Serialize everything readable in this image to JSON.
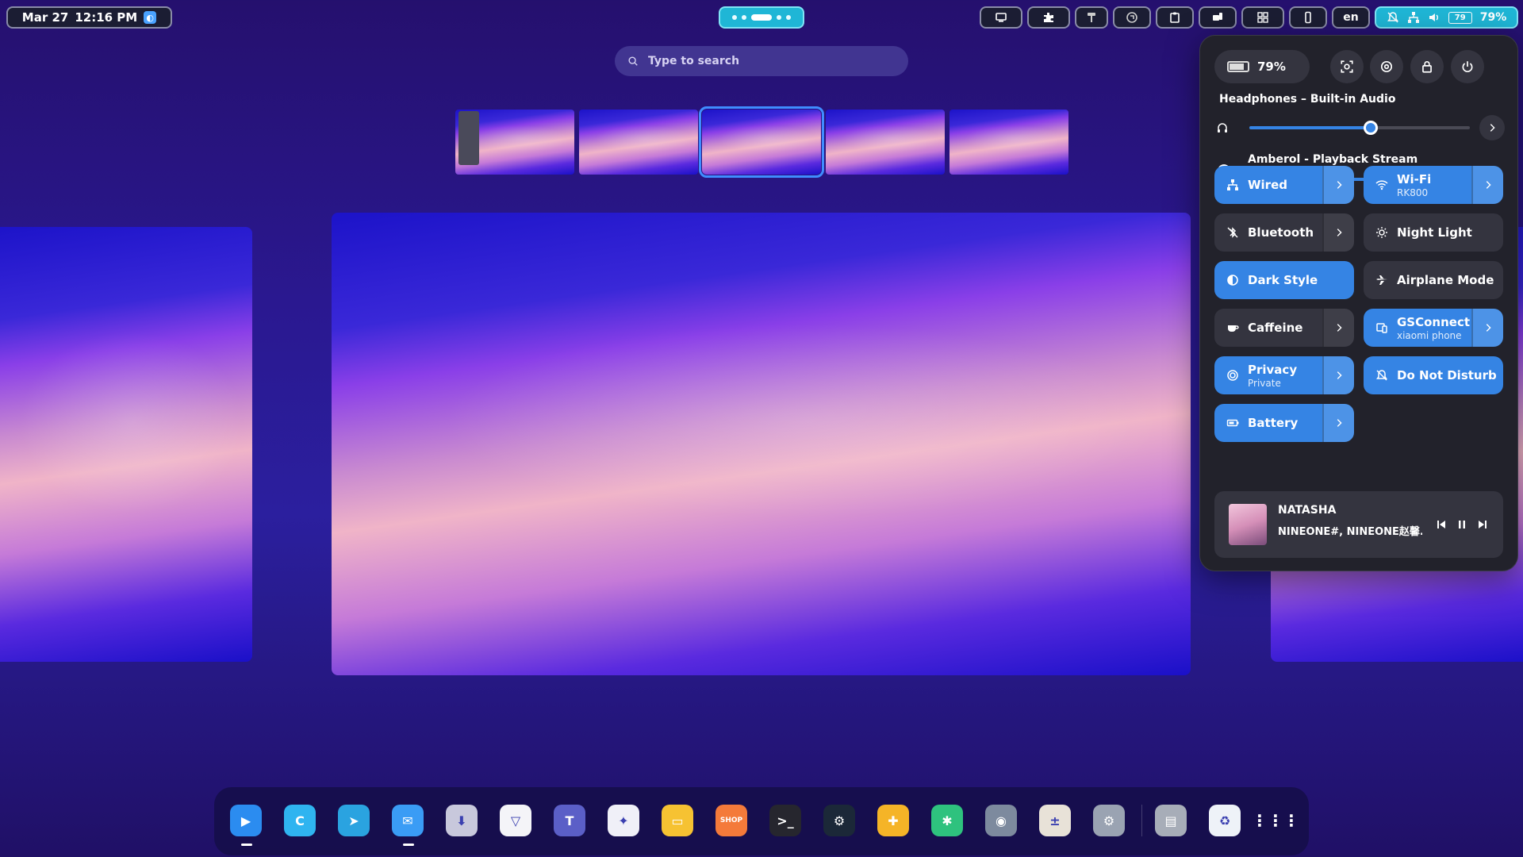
{
  "topbar": {
    "date": "Mar 27",
    "time": "12:16 PM",
    "tray_lang": "en",
    "tray_battery_icon_text": "79",
    "tray_battery_percent": "79%"
  },
  "search": {
    "placeholder": "Type to search"
  },
  "quick_settings": {
    "battery_percent": "79%",
    "output_device_label": "Headphones – Built-in Audio",
    "output_volume": 0.55,
    "stream_label": "Amberol - Playback Stream",
    "stream_volume": 0.52,
    "tiles": [
      {
        "label": "Wired",
        "sub": "",
        "on": true,
        "arrow": true
      },
      {
        "label": "Wi-Fi",
        "sub": "RK800",
        "on": true,
        "arrow": true
      },
      {
        "label": "Bluetooth",
        "sub": "",
        "on": false,
        "arrow": true
      },
      {
        "label": "Night Light",
        "sub": "",
        "on": false,
        "arrow": false
      },
      {
        "label": "Dark Style",
        "sub": "",
        "on": true,
        "arrow": false
      },
      {
        "label": "Airplane Mode",
        "sub": "",
        "on": false,
        "arrow": false
      },
      {
        "label": "Caffeine",
        "sub": "",
        "on": false,
        "arrow": true
      },
      {
        "label": "GSConnect",
        "sub": "xiaomi phone",
        "on": true,
        "arrow": true
      },
      {
        "label": "Privacy",
        "sub": "Private",
        "on": true,
        "arrow": true
      },
      {
        "label": "Do Not Disturb",
        "sub": "",
        "on": true,
        "arrow": false
      },
      {
        "label": "Battery",
        "sub": "",
        "on": true,
        "arrow": true
      }
    ],
    "media": {
      "title": "NATASHA",
      "artist": "NINEONE#, NINEONE赵馨..."
    }
  },
  "dock": {
    "apps": [
      {
        "name": "video-player",
        "color": "#2b8cf0",
        "glyph": "▶"
      },
      {
        "name": "browser-c",
        "color": "#2fb4f0",
        "glyph": "C"
      },
      {
        "name": "telegram",
        "color": "#2aa3e0",
        "glyph": "➤"
      },
      {
        "name": "mail",
        "color": "#3a9cf5",
        "glyph": "✉"
      },
      {
        "name": "downloader",
        "color": "#c8c8dc",
        "glyph": "⬇"
      },
      {
        "name": "proton-vpn",
        "color": "#f4f4f8",
        "glyph": "▽"
      },
      {
        "name": "teams",
        "color": "#5b5fc7",
        "glyph": "T"
      },
      {
        "name": "messenger",
        "color": "#f0f0f8",
        "glyph": "✦"
      },
      {
        "name": "files",
        "color": "#f6c232",
        "glyph": "▭"
      },
      {
        "name": "shop",
        "color": "#f47a3a",
        "glyph": "SHOP"
      },
      {
        "name": "terminal",
        "color": "#26262e",
        "glyph": ">_"
      },
      {
        "name": "steam",
        "color": "#1b2838",
        "glyph": "⚙"
      },
      {
        "name": "game-controller",
        "color": "#f5b427",
        "glyph": "✚"
      },
      {
        "name": "extensions",
        "color": "#2ec27e",
        "glyph": "✱"
      },
      {
        "name": "toggle-app",
        "color": "#7d8a9e",
        "glyph": "◉"
      },
      {
        "name": "calculator",
        "color": "#e8e2d8",
        "glyph": "±"
      },
      {
        "name": "settings",
        "color": "#9aa3b2",
        "glyph": "⚙"
      },
      {
        "name": "disk-utility",
        "color": "#a7adb8",
        "glyph": "▤"
      },
      {
        "name": "recycle-bin",
        "color": "#eef2f8",
        "glyph": "♻"
      },
      {
        "name": "app-grid",
        "color": "transparent",
        "glyph": "⋮⋮⋮"
      }
    ]
  }
}
